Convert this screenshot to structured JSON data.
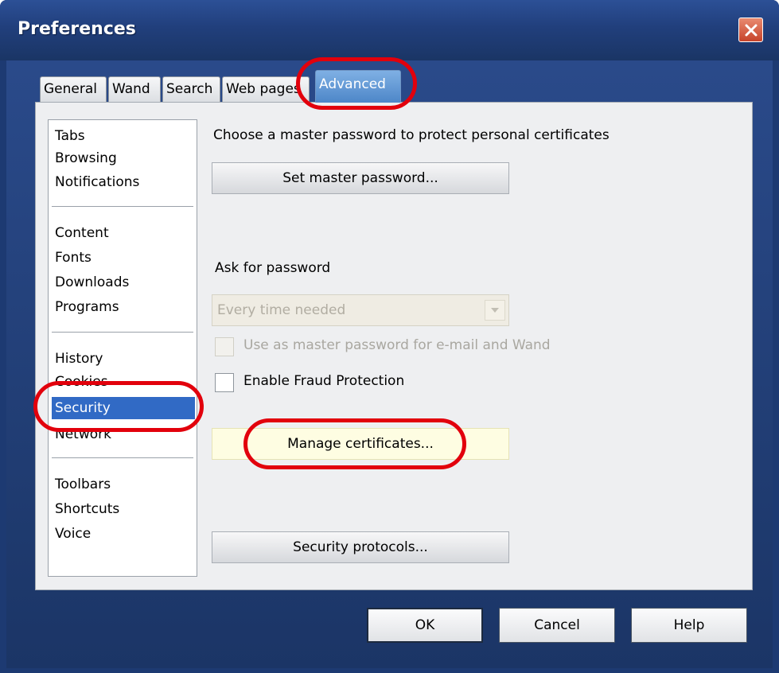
{
  "window": {
    "title": "Preferences"
  },
  "tabs": [
    {
      "label": "General"
    },
    {
      "label": "Wand"
    },
    {
      "label": "Search"
    },
    {
      "label": "Web pages"
    },
    {
      "label": "Advanced",
      "active": true
    }
  ],
  "sidebar": {
    "groups": [
      [
        "Tabs",
        "Browsing",
        "Notifications"
      ],
      [
        "Content",
        "Fonts",
        "Downloads",
        "Programs"
      ],
      [
        "History",
        "Cookies",
        "Security",
        "Network"
      ],
      [
        "Toolbars",
        "Shortcuts",
        "Voice"
      ]
    ],
    "selected": "Security"
  },
  "content": {
    "master_password_label": "Choose a master password to protect personal certificates",
    "set_master_password_button": "Set master password...",
    "ask_for_password_label": "Ask for password",
    "ask_for_password_value": "Every time needed",
    "use_master_password_label": "Use as master password for e-mail and Wand",
    "use_master_password_checked": false,
    "use_master_password_enabled": false,
    "fraud_protection_label": "Enable Fraud Protection",
    "fraud_protection_checked": false,
    "manage_certificates_button": "Manage certificates...",
    "security_protocols_button": "Security protocols..."
  },
  "footer": {
    "ok": "OK",
    "cancel": "Cancel",
    "help": "Help"
  },
  "colors": {
    "titlebar": "#213f7c",
    "selection": "#316ac5",
    "annotation_ring": "#e2000c",
    "highlight_button": "#fefde2"
  },
  "icons": {
    "close": "close-icon",
    "dropdown": "chevron-down-icon"
  }
}
